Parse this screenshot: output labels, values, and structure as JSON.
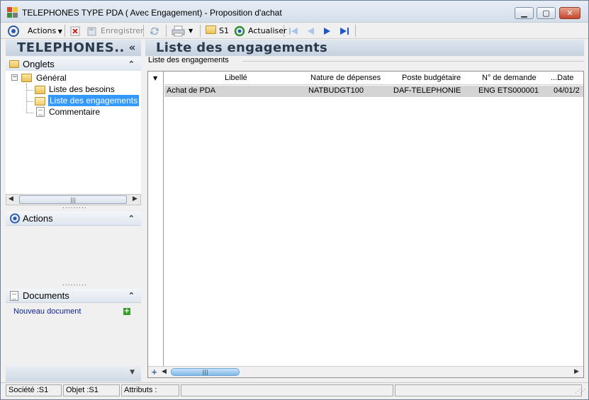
{
  "window": {
    "title": "TELEPHONES TYPE PDA ( Avec Engagement) -  Proposition d'achat",
    "minimize": "▁",
    "maximize": "▢",
    "close": "✕"
  },
  "toolbar": {
    "actions_label": "Actions",
    "save_label": "Enregistrer",
    "s1_label": "S1",
    "refresh_label": "Actualiser"
  },
  "left_panel": {
    "title": "TELEPHONES..",
    "collapse_glyph": "«",
    "onglets": {
      "label": "Onglets",
      "chevron": "⌃",
      "root": "Général",
      "items": [
        "Liste des besoins",
        "Liste des engagements",
        "Commentaire"
      ],
      "selected_index": 1
    },
    "actions": {
      "label": "Actions",
      "chevron": "⌃"
    },
    "documents": {
      "label": "Documents",
      "chevron": "⌃",
      "new_doc": "Nouveau document"
    },
    "scroll_thumb": "|||",
    "splitter": "........."
  },
  "main": {
    "title": "Liste des engagements",
    "group_label": "Liste des engagements",
    "columns": [
      "Libellé",
      "Nature de dépenses",
      "Poste budgétaire",
      "N° de demande",
      "...Date"
    ],
    "rows": [
      [
        "Achat de PDA",
        "NATBUDGT100",
        "DAF-TELEPHONIE",
        "ENG ETS000001",
        "04/01/2"
      ]
    ],
    "scroll_thumb": "|||",
    "add_glyph": "+"
  },
  "statusbar": {
    "societe": "Société :S1",
    "objet": "Objet :S1",
    "attributs": "Attributs :"
  },
  "colors": {
    "header_gradient_top": "#dfe6ef",
    "header_gradient_bottom": "#c5d1df",
    "header_text": "#2b3a4d",
    "selection": "#3399ff",
    "row_bg": "#d4d4d4",
    "link": "#0b1f8f"
  }
}
